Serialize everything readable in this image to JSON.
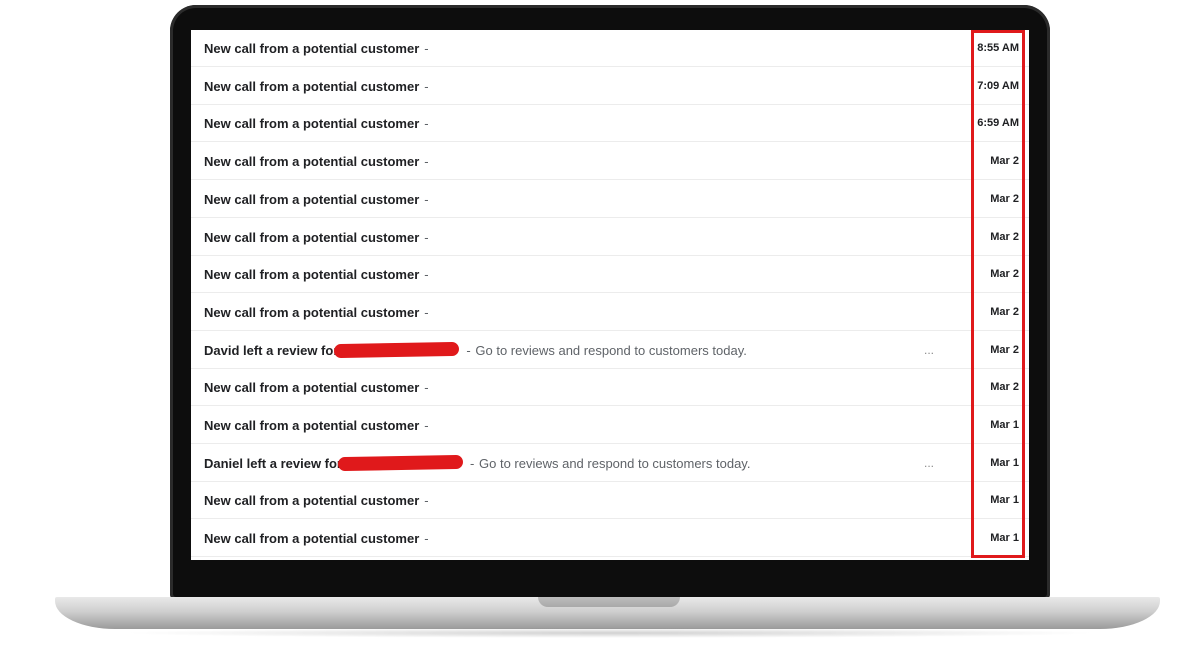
{
  "emails": [
    {
      "subject": "New call from a potential customer",
      "separator": "-",
      "snippet": "",
      "date": "8:55 AM",
      "redacted": false,
      "has_more": false
    },
    {
      "subject": "New call from a potential customer",
      "separator": "-",
      "snippet": "",
      "date": "7:09 AM",
      "redacted": false,
      "has_more": false
    },
    {
      "subject": "New call from a potential customer",
      "separator": "-",
      "snippet": "",
      "date": "6:59 AM",
      "redacted": false,
      "has_more": false
    },
    {
      "subject": "New call from a potential customer",
      "separator": "-",
      "snippet": "",
      "date": "Mar 2",
      "redacted": false,
      "has_more": false
    },
    {
      "subject": "New call from a potential customer",
      "separator": "-",
      "snippet": "",
      "date": "Mar 2",
      "redacted": false,
      "has_more": false
    },
    {
      "subject": "New call from a potential customer",
      "separator": "-",
      "snippet": "",
      "date": "Mar 2",
      "redacted": false,
      "has_more": false
    },
    {
      "subject": "New call from a potential customer",
      "separator": "-",
      "snippet": "",
      "date": "Mar 2",
      "redacted": false,
      "has_more": false
    },
    {
      "subject": "New call from a potential customer",
      "separator": "-",
      "snippet": "",
      "date": "Mar 2",
      "redacted": false,
      "has_more": false
    },
    {
      "subject": "David left a review for",
      "separator": "-",
      "snippet": "Go to reviews and respond to customers today.",
      "date": "Mar 2",
      "redacted": true,
      "has_more": true
    },
    {
      "subject": "New call from a potential customer",
      "separator": "-",
      "snippet": "",
      "date": "Mar 2",
      "redacted": false,
      "has_more": false
    },
    {
      "subject": "New call from a potential customer",
      "separator": "-",
      "snippet": "",
      "date": "Mar 1",
      "redacted": false,
      "has_more": false
    },
    {
      "subject": "Daniel left a review for",
      "separator": "-",
      "snippet": "Go to reviews and respond to customers today.",
      "date": "Mar 1",
      "redacted": true,
      "has_more": true
    },
    {
      "subject": "New call from a potential customer",
      "separator": "-",
      "snippet": "",
      "date": "Mar 1",
      "redacted": false,
      "has_more": false
    },
    {
      "subject": "New call from a potential customer",
      "separator": "-",
      "snippet": "",
      "date": "Mar 1",
      "redacted": false,
      "has_more": false
    }
  ],
  "more_label": "...",
  "colors": {
    "highlight": "#e0191b",
    "subject_text": "#202124",
    "snippet_text": "#5f6368"
  }
}
